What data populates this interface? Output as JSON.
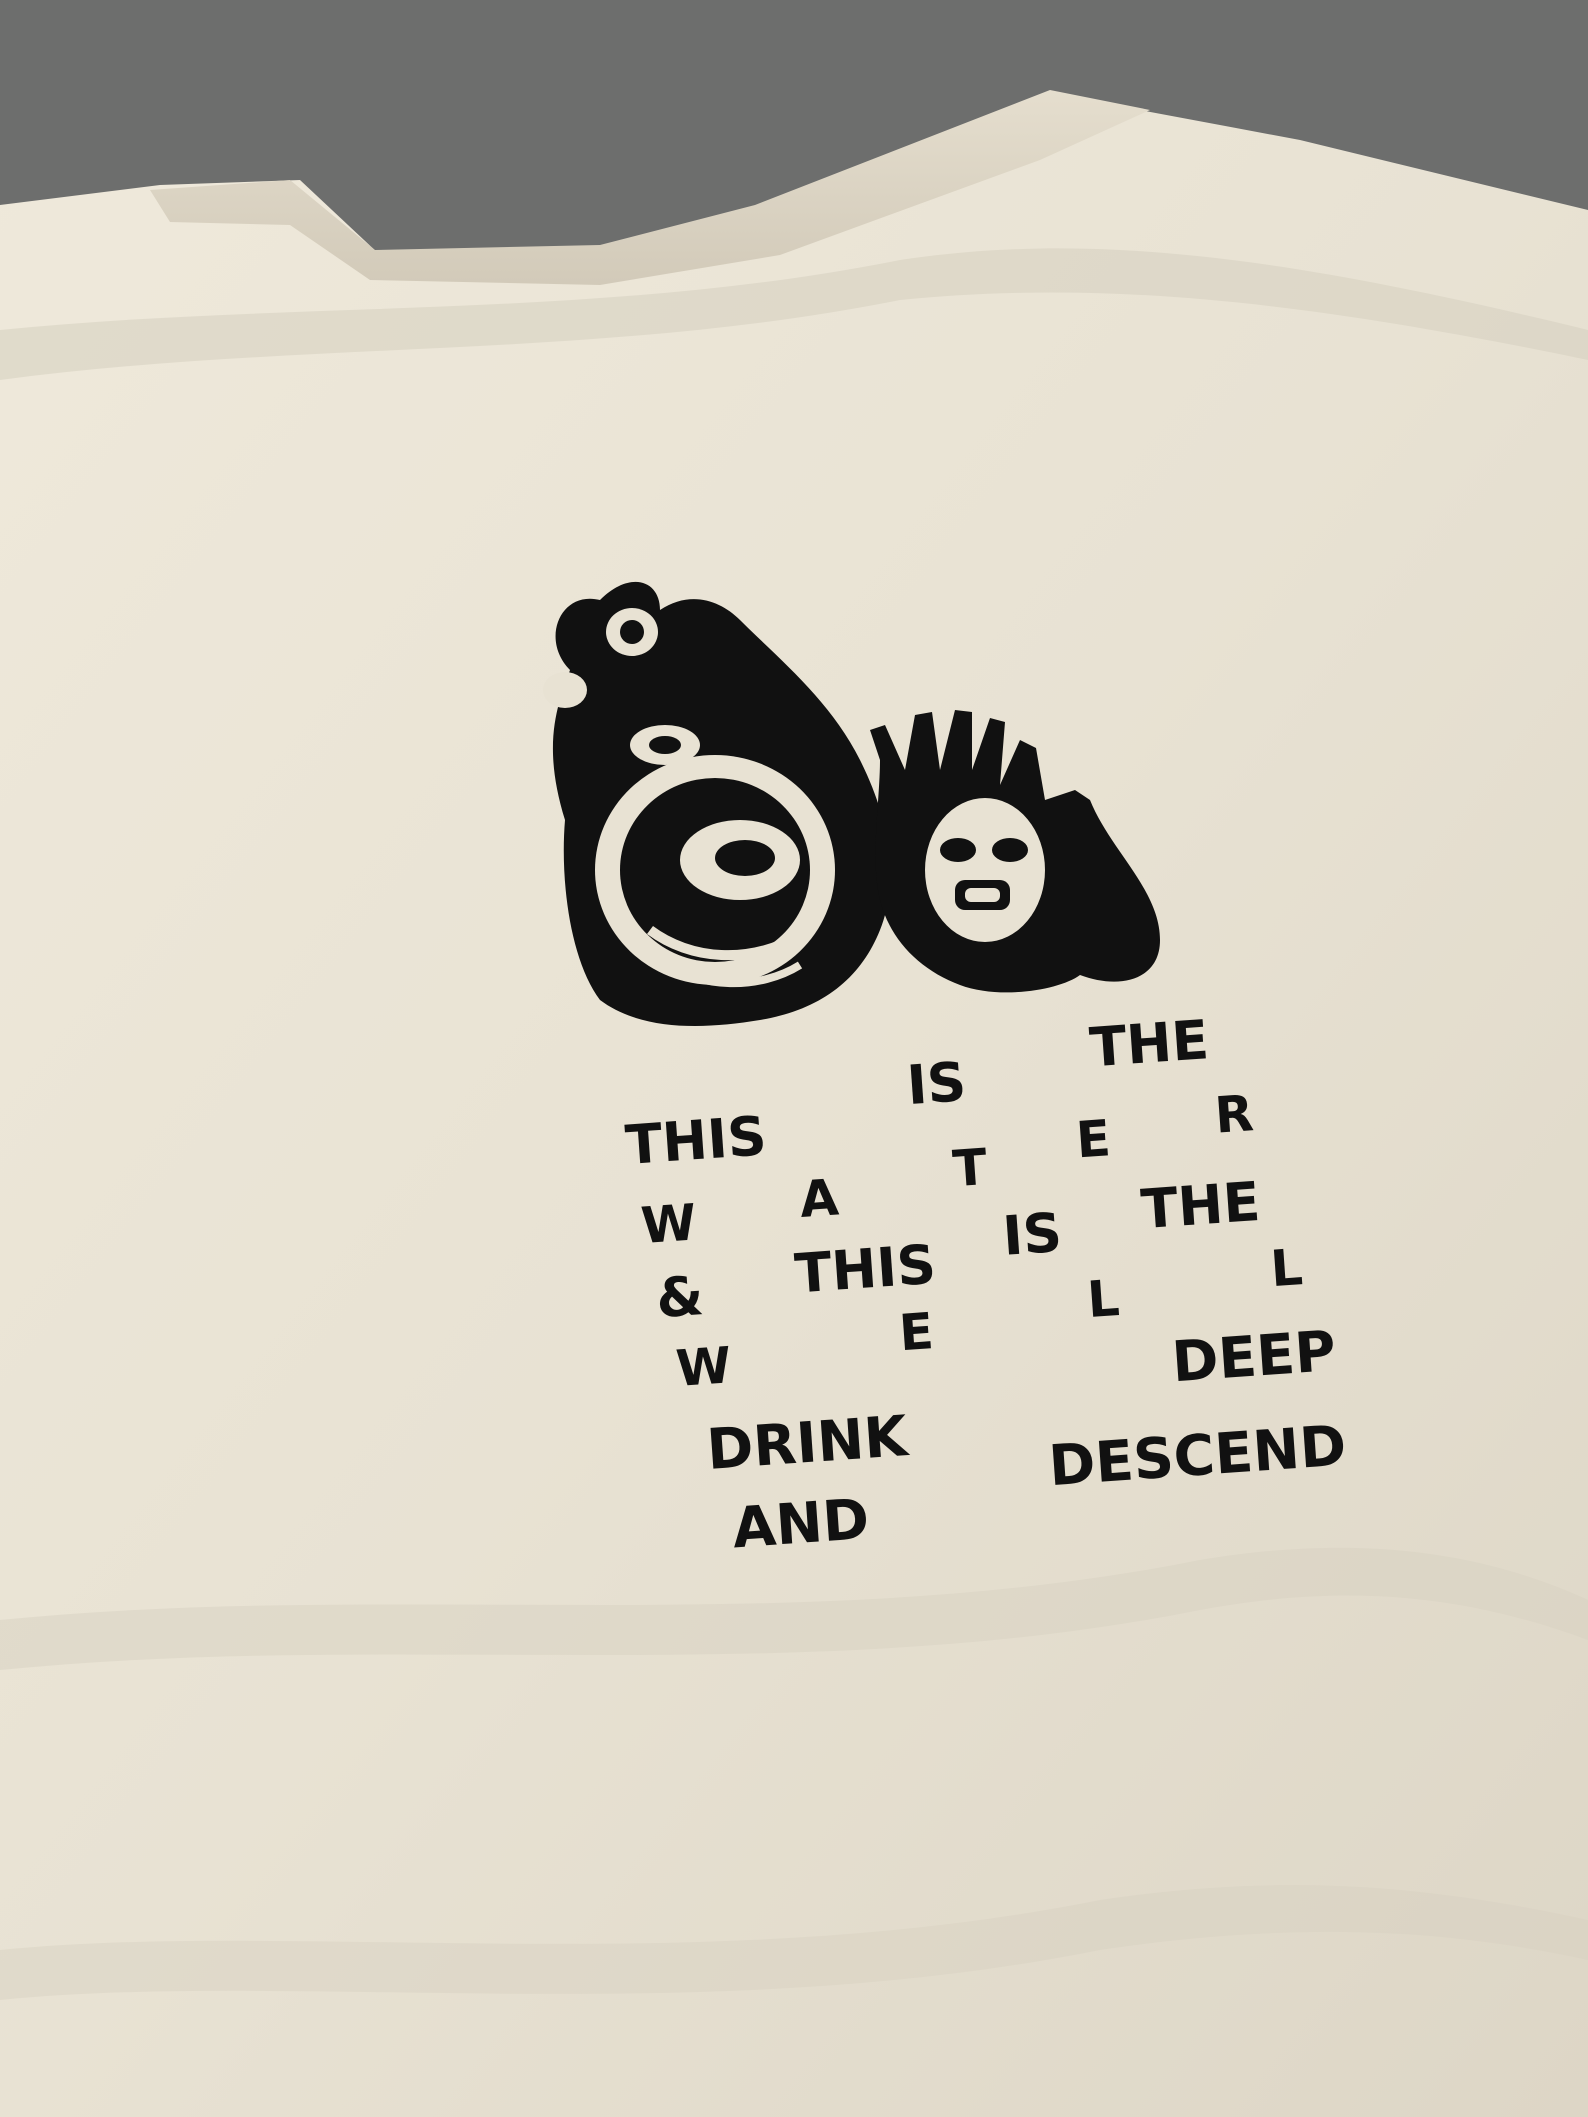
{
  "scene": {
    "subject": "cream-t-shirt-back",
    "colors": {
      "background": "#6f706f",
      "shirt": "#e9e3d4",
      "shirt_shadow": "#cfc8b8",
      "ink": "#111111"
    }
  },
  "print": {
    "lines": [
      {
        "id": "line-1",
        "words": [
          "THIS",
          "IS",
          "THE"
        ]
      },
      {
        "id": "line-2",
        "words": [
          "W",
          "A",
          "T",
          "E",
          "R"
        ]
      },
      {
        "id": "line-3",
        "words": [
          "&",
          "THIS",
          "IS",
          "THE"
        ]
      },
      {
        "id": "line-4",
        "words": [
          "W",
          "E",
          "L",
          "L"
        ]
      },
      {
        "id": "line-5",
        "words": [
          "DRINK",
          "DEEP"
        ]
      },
      {
        "id": "line-6",
        "words": [
          "AND",
          "DESCEND"
        ]
      }
    ]
  }
}
